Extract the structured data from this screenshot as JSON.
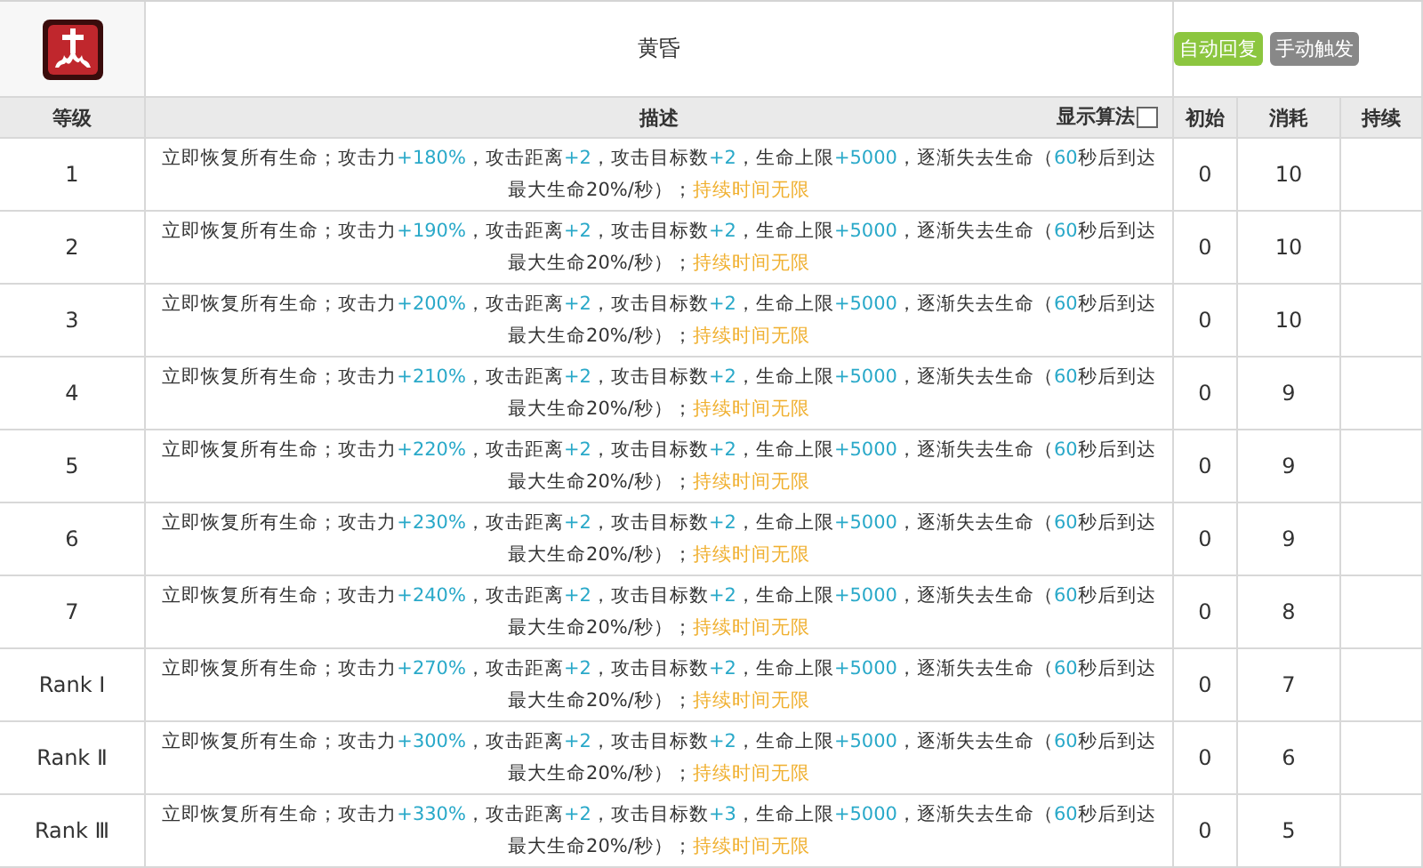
{
  "skill": {
    "title": "黄昏",
    "tags": [
      {
        "label": "自动回复",
        "color": "#8cc63f"
      },
      {
        "label": "手动触发",
        "color": "#888888"
      }
    ]
  },
  "columns": {
    "level": "等级",
    "description": "描述",
    "formula_toggle": {
      "label": "显示算法",
      "checked": false
    },
    "initial": "初始",
    "cost": "消耗",
    "duration": "持续"
  },
  "rows": [
    {
      "level": "1",
      "initial": "0",
      "cost": "10",
      "lines": [
        [
          {
            "kind": "plain",
            "text": "立即恢复所有生命；攻击力"
          },
          {
            "kind": "value",
            "text": "+180%"
          },
          {
            "kind": "plain",
            "text": "，攻击距离"
          },
          {
            "kind": "value",
            "text": "+2"
          },
          {
            "kind": "plain",
            "text": "，攻击目标数"
          },
          {
            "kind": "value",
            "text": "+2"
          },
          {
            "kind": "plain",
            "text": "，生命上限"
          },
          {
            "kind": "value",
            "text": "+5000"
          },
          {
            "kind": "plain",
            "text": "，逐渐失去生命（"
          },
          {
            "kind": "value",
            "text": "60"
          },
          {
            "kind": "plain",
            "text": "秒后到达"
          }
        ],
        [
          {
            "kind": "plain",
            "text": "最大生命20%/秒）；"
          },
          {
            "kind": "duration",
            "text": "持续时间无限"
          }
        ]
      ]
    },
    {
      "level": "2",
      "initial": "0",
      "cost": "10",
      "lines": [
        [
          {
            "kind": "plain",
            "text": "立即恢复所有生命；攻击力"
          },
          {
            "kind": "value",
            "text": "+190%"
          },
          {
            "kind": "plain",
            "text": "，攻击距离"
          },
          {
            "kind": "value",
            "text": "+2"
          },
          {
            "kind": "plain",
            "text": "，攻击目标数"
          },
          {
            "kind": "value",
            "text": "+2"
          },
          {
            "kind": "plain",
            "text": "，生命上限"
          },
          {
            "kind": "value",
            "text": "+5000"
          },
          {
            "kind": "plain",
            "text": "，逐渐失去生命（"
          },
          {
            "kind": "value",
            "text": "60"
          },
          {
            "kind": "plain",
            "text": "秒后到达"
          }
        ],
        [
          {
            "kind": "plain",
            "text": "最大生命20%/秒）；"
          },
          {
            "kind": "duration",
            "text": "持续时间无限"
          }
        ]
      ]
    },
    {
      "level": "3",
      "initial": "0",
      "cost": "10",
      "lines": [
        [
          {
            "kind": "plain",
            "text": "立即恢复所有生命；攻击力"
          },
          {
            "kind": "value",
            "text": "+200%"
          },
          {
            "kind": "plain",
            "text": "，攻击距离"
          },
          {
            "kind": "value",
            "text": "+2"
          },
          {
            "kind": "plain",
            "text": "，攻击目标数"
          },
          {
            "kind": "value",
            "text": "+2"
          },
          {
            "kind": "plain",
            "text": "，生命上限"
          },
          {
            "kind": "value",
            "text": "+5000"
          },
          {
            "kind": "plain",
            "text": "，逐渐失去生命（"
          },
          {
            "kind": "value",
            "text": "60"
          },
          {
            "kind": "plain",
            "text": "秒后到达"
          }
        ],
        [
          {
            "kind": "plain",
            "text": "最大生命20%/秒）；"
          },
          {
            "kind": "duration",
            "text": "持续时间无限"
          }
        ]
      ]
    },
    {
      "level": "4",
      "initial": "0",
      "cost": "9",
      "lines": [
        [
          {
            "kind": "plain",
            "text": "立即恢复所有生命；攻击力"
          },
          {
            "kind": "value",
            "text": "+210%"
          },
          {
            "kind": "plain",
            "text": "，攻击距离"
          },
          {
            "kind": "value",
            "text": "+2"
          },
          {
            "kind": "plain",
            "text": "，攻击目标数"
          },
          {
            "kind": "value",
            "text": "+2"
          },
          {
            "kind": "plain",
            "text": "，生命上限"
          },
          {
            "kind": "value",
            "text": "+5000"
          },
          {
            "kind": "plain",
            "text": "，逐渐失去生命（"
          },
          {
            "kind": "value",
            "text": "60"
          },
          {
            "kind": "plain",
            "text": "秒后到达"
          }
        ],
        [
          {
            "kind": "plain",
            "text": "最大生命20%/秒）；"
          },
          {
            "kind": "duration",
            "text": "持续时间无限"
          }
        ]
      ]
    },
    {
      "level": "5",
      "initial": "0",
      "cost": "9",
      "lines": [
        [
          {
            "kind": "plain",
            "text": "立即恢复所有生命；攻击力"
          },
          {
            "kind": "value",
            "text": "+220%"
          },
          {
            "kind": "plain",
            "text": "，攻击距离"
          },
          {
            "kind": "value",
            "text": "+2"
          },
          {
            "kind": "plain",
            "text": "，攻击目标数"
          },
          {
            "kind": "value",
            "text": "+2"
          },
          {
            "kind": "plain",
            "text": "，生命上限"
          },
          {
            "kind": "value",
            "text": "+5000"
          },
          {
            "kind": "plain",
            "text": "，逐渐失去生命（"
          },
          {
            "kind": "value",
            "text": "60"
          },
          {
            "kind": "plain",
            "text": "秒后到达"
          }
        ],
        [
          {
            "kind": "plain",
            "text": "最大生命20%/秒）；"
          },
          {
            "kind": "duration",
            "text": "持续时间无限"
          }
        ]
      ]
    },
    {
      "level": "6",
      "initial": "0",
      "cost": "9",
      "lines": [
        [
          {
            "kind": "plain",
            "text": "立即恢复所有生命；攻击力"
          },
          {
            "kind": "value",
            "text": "+230%"
          },
          {
            "kind": "plain",
            "text": "，攻击距离"
          },
          {
            "kind": "value",
            "text": "+2"
          },
          {
            "kind": "plain",
            "text": "，攻击目标数"
          },
          {
            "kind": "value",
            "text": "+2"
          },
          {
            "kind": "plain",
            "text": "，生命上限"
          },
          {
            "kind": "value",
            "text": "+5000"
          },
          {
            "kind": "plain",
            "text": "，逐渐失去生命（"
          },
          {
            "kind": "value",
            "text": "60"
          },
          {
            "kind": "plain",
            "text": "秒后到达"
          }
        ],
        [
          {
            "kind": "plain",
            "text": "最大生命20%/秒）；"
          },
          {
            "kind": "duration",
            "text": "持续时间无限"
          }
        ]
      ]
    },
    {
      "level": "7",
      "initial": "0",
      "cost": "8",
      "lines": [
        [
          {
            "kind": "plain",
            "text": "立即恢复所有生命；攻击力"
          },
          {
            "kind": "value",
            "text": "+240%"
          },
          {
            "kind": "plain",
            "text": "，攻击距离"
          },
          {
            "kind": "value",
            "text": "+2"
          },
          {
            "kind": "plain",
            "text": "，攻击目标数"
          },
          {
            "kind": "value",
            "text": "+2"
          },
          {
            "kind": "plain",
            "text": "，生命上限"
          },
          {
            "kind": "value",
            "text": "+5000"
          },
          {
            "kind": "plain",
            "text": "，逐渐失去生命（"
          },
          {
            "kind": "value",
            "text": "60"
          },
          {
            "kind": "plain",
            "text": "秒后到达"
          }
        ],
        [
          {
            "kind": "plain",
            "text": "最大生命20%/秒）；"
          },
          {
            "kind": "duration",
            "text": "持续时间无限"
          }
        ]
      ]
    },
    {
      "level": "Rank Ⅰ",
      "initial": "0",
      "cost": "7",
      "lines": [
        [
          {
            "kind": "plain",
            "text": "立即恢复所有生命；攻击力"
          },
          {
            "kind": "value",
            "text": "+270%"
          },
          {
            "kind": "plain",
            "text": "，攻击距离"
          },
          {
            "kind": "value",
            "text": "+2"
          },
          {
            "kind": "plain",
            "text": "，攻击目标数"
          },
          {
            "kind": "value",
            "text": "+2"
          },
          {
            "kind": "plain",
            "text": "，生命上限"
          },
          {
            "kind": "value",
            "text": "+5000"
          },
          {
            "kind": "plain",
            "text": "，逐渐失去生命（"
          },
          {
            "kind": "value",
            "text": "60"
          },
          {
            "kind": "plain",
            "text": "秒后到达"
          }
        ],
        [
          {
            "kind": "plain",
            "text": "最大生命20%/秒）；"
          },
          {
            "kind": "duration",
            "text": "持续时间无限"
          }
        ]
      ]
    },
    {
      "level": "Rank Ⅱ",
      "initial": "0",
      "cost": "6",
      "lines": [
        [
          {
            "kind": "plain",
            "text": "立即恢复所有生命；攻击力"
          },
          {
            "kind": "value",
            "text": "+300%"
          },
          {
            "kind": "plain",
            "text": "，攻击距离"
          },
          {
            "kind": "value",
            "text": "+2"
          },
          {
            "kind": "plain",
            "text": "，攻击目标数"
          },
          {
            "kind": "value",
            "text": "+2"
          },
          {
            "kind": "plain",
            "text": "，生命上限"
          },
          {
            "kind": "value",
            "text": "+5000"
          },
          {
            "kind": "plain",
            "text": "，逐渐失去生命（"
          },
          {
            "kind": "value",
            "text": "60"
          },
          {
            "kind": "plain",
            "text": "秒后到达"
          }
        ],
        [
          {
            "kind": "plain",
            "text": "最大生命20%/秒）；"
          },
          {
            "kind": "duration",
            "text": "持续时间无限"
          }
        ]
      ]
    },
    {
      "level": "Rank Ⅲ",
      "initial": "0",
      "cost": "5",
      "lines": [
        [
          {
            "kind": "plain",
            "text": "立即恢复所有生命；攻击力"
          },
          {
            "kind": "value",
            "text": "+330%"
          },
          {
            "kind": "plain",
            "text": "，攻击距离"
          },
          {
            "kind": "value",
            "text": "+2"
          },
          {
            "kind": "plain",
            "text": "，攻击目标数"
          },
          {
            "kind": "value",
            "text": "+3"
          },
          {
            "kind": "plain",
            "text": "，生命上限"
          },
          {
            "kind": "value",
            "text": "+5000"
          },
          {
            "kind": "plain",
            "text": "，逐渐失去生命（"
          },
          {
            "kind": "value",
            "text": "60"
          },
          {
            "kind": "plain",
            "text": "秒后到达"
          }
        ],
        [
          {
            "kind": "plain",
            "text": "最大生命20%/秒）；"
          },
          {
            "kind": "duration",
            "text": "持续时间无限"
          }
        ]
      ]
    }
  ]
}
